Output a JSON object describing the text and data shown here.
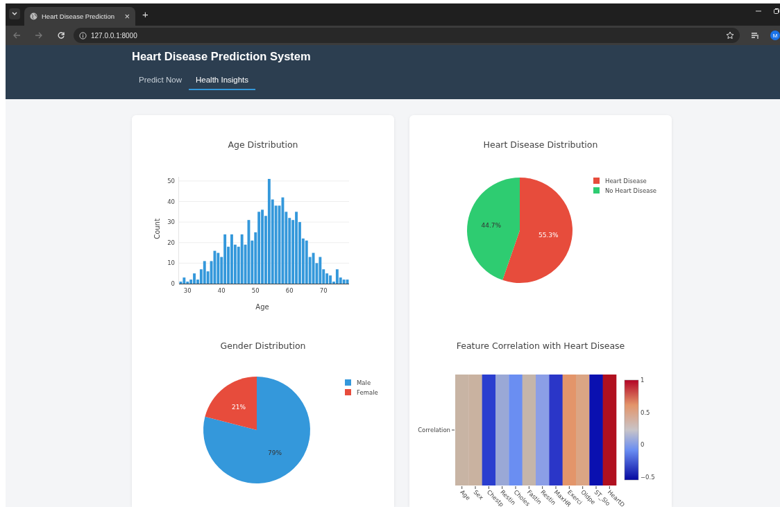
{
  "browser": {
    "tab": {
      "title": "Heart Disease Prediction",
      "close": "×"
    },
    "new_tab": "+",
    "address": "127.0.0.1:8000",
    "profile_initial": "M"
  },
  "header": {
    "title": "Heart Disease Prediction System",
    "nav": [
      {
        "label": "Predict Now",
        "selected": false
      },
      {
        "label": "Health Insights",
        "selected": true
      }
    ]
  },
  "cards": [
    {
      "panels": [
        {
          "kind": "chart",
          "chart_data": {
            "type": "bar",
            "title": "Age Distribution",
            "xlabel": "Age",
            "ylabel": "Count",
            "x": [
              28,
              29,
              30,
              31,
              32,
              33,
              34,
              35,
              36,
              37,
              38,
              39,
              40,
              41,
              42,
              43,
              44,
              45,
              46,
              47,
              48,
              49,
              50,
              51,
              52,
              53,
              54,
              55,
              56,
              57,
              58,
              59,
              60,
              61,
              62,
              63,
              64,
              65,
              66,
              67,
              68,
              69,
              70,
              71,
              72,
              73,
              74,
              75,
              76,
              77
            ],
            "series": [
              {
                "color": "#3498db",
                "values": [
                  1,
                  3,
                  1,
                  2,
                  5,
                  2,
                  7,
                  11,
                  6,
                  11,
                  16,
                  15,
                  13,
                  24,
                  18,
                  24,
                  19,
                  18,
                  24,
                  19,
                  31,
                  21,
                  25,
                  35,
                  36,
                  33,
                  51,
                  41,
                  38,
                  38,
                  42,
                  35,
                  32,
                  31,
                  35,
                  30,
                  22,
                  21,
                  13,
                  15,
                  10,
                  13,
                  7,
                  5,
                  4,
                  1,
                  7,
                  3,
                  2,
                  2
                ]
              }
            ],
            "xlim": [
              27.5,
              77.5
            ],
            "ylim": [
              0,
              52
            ],
            "grid": true,
            "xticks": [
              30,
              40,
              50,
              60,
              70
            ],
            "yticks": [
              0,
              10,
              20,
              30,
              40,
              50
            ]
          }
        },
        {
          "kind": "chart",
          "chart_data": {
            "type": "pie",
            "title": "Gender Distribution",
            "categories": [
              "Male",
              "Female"
            ],
            "values": [
              79,
              21
            ],
            "colors": [
              "#3498db",
              "#e74c3c"
            ],
            "value_labels": [
              "79%",
              "21%"
            ],
            "legend": "top-right"
          }
        }
      ]
    },
    {
      "panels": [
        {
          "kind": "chart",
          "chart_data": {
            "type": "pie",
            "title": "Heart Disease Distribution",
            "categories": [
              "Heart Disease",
              "No Heart Disease"
            ],
            "values": [
              55.3,
              44.7
            ],
            "colors": [
              "#e74c3c",
              "#2ecc71"
            ],
            "value_labels": [
              "55.3%",
              "44.7%"
            ],
            "legend": "top-right"
          }
        },
        {
          "kind": "heatmap",
          "heatmap": {
            "title": "Feature Correlation with Heart Disease",
            "row_label": "Correlation",
            "columns": [
              {
                "label": "Age",
                "color": "#c8b4a4"
              },
              {
                "label": "Sex",
                "color": "#c9b2a0"
              },
              {
                "label": "Chestp",
                "color": "#2a3ecf"
              },
              {
                "label": "Restin",
                "color": "#9aa8d6"
              },
              {
                "label": "Choles",
                "color": "#6a8ef2"
              },
              {
                "label": "Fastin",
                "color": "#c4b5aa"
              },
              {
                "label": "Restin",
                "color": "#8b9ee6"
              },
              {
                "label": "MaxHR",
                "color": "#2a36c8"
              },
              {
                "label": "Exerci",
                "color": "#e3956a"
              },
              {
                "label": "Oldpe",
                "color": "#dba584"
              },
              {
                "label": "ST_Slo",
                "color": "#0a10b0"
              },
              {
                "label": "HeartD",
                "color": "#b0101f"
              }
            ],
            "colorbar_ticks": [
              "1",
              "0.5",
              "0",
              "−0.5"
            ]
          }
        }
      ]
    }
  ]
}
